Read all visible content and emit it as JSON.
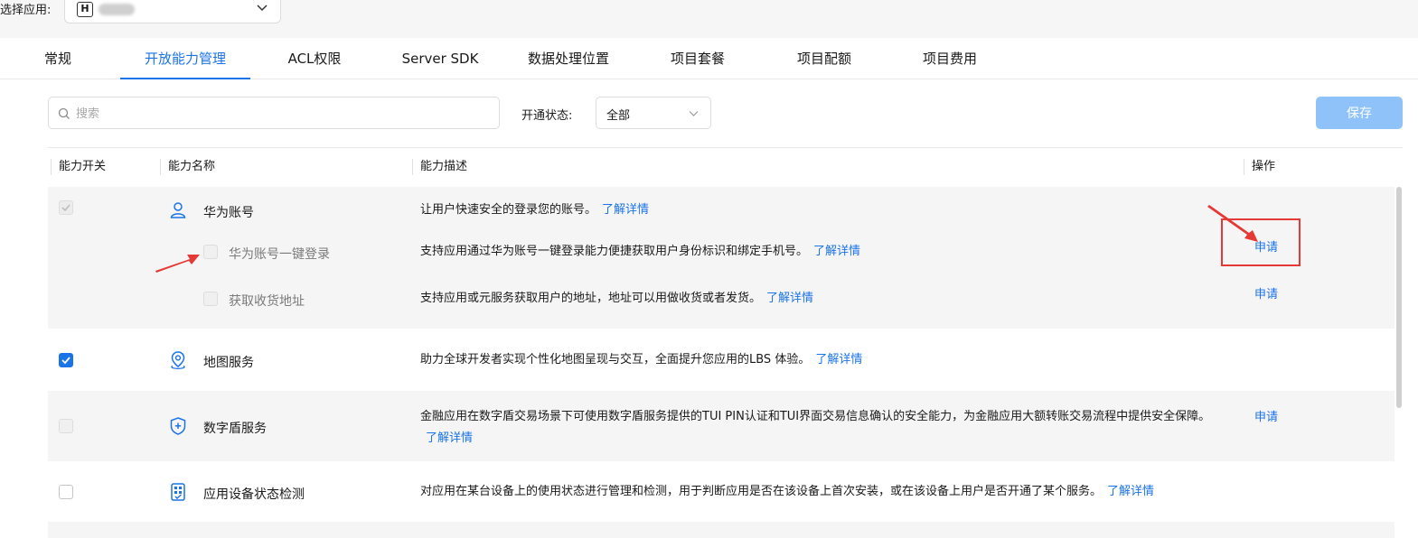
{
  "header": {
    "app_label": "选择应用:",
    "app_badge": "H"
  },
  "tabs": [
    "常规",
    "开放能力管理",
    "ACL权限",
    "Server SDK",
    "数据处理位置",
    "项目套餐",
    "项目配额",
    "项目费用"
  ],
  "active_tab": "开放能力管理",
  "filters": {
    "search_placeholder": "搜索",
    "status_label": "开通状态:",
    "status_value": "全部",
    "save_label": "保存"
  },
  "table": {
    "headers": [
      "能力开关",
      "能力名称",
      "能力描述",
      "操作"
    ],
    "link_text": "了解详情",
    "apply_text": "申请",
    "rows": [
      {
        "name": "华为账号",
        "icon": "user-icon",
        "checked": true,
        "disabled": true,
        "desc": "让用户快速安全的登录您的账号。",
        "action": ""
      },
      {
        "name": "华为账号一键登录",
        "icon": "",
        "checked": false,
        "disabled": true,
        "sub": true,
        "desc": "支持应用通过华为账号一键登录能力便捷获取用户身份标识和绑定手机号。",
        "action": "申请"
      },
      {
        "name": "获取收货地址",
        "icon": "",
        "checked": false,
        "disabled": true,
        "sub": true,
        "desc": "支持应用或元服务获取用户的地址，地址可以用做收货或者发货。",
        "action": "申请"
      },
      {
        "name": "地图服务",
        "icon": "map-pin-icon",
        "checked": true,
        "disabled": false,
        "desc": "助力全球开发者实现个性化地图呈现与交互，全面提升您应用的LBS 体验。",
        "action": ""
      },
      {
        "name": "数字盾服务",
        "icon": "shield-plus-icon",
        "checked": false,
        "disabled": true,
        "desc": "金融应用在数字盾交易场景下可使用数字盾服务提供的TUI PIN认证和TUI界面交易信息确认的安全能力，为金融应用大额转账交易流程中提供安全保障。",
        "action": "申请"
      },
      {
        "name": "应用设备状态检测",
        "icon": "device-check-icon",
        "checked": false,
        "disabled": false,
        "desc": "对应用在某台设备上的使用状态进行管理和检测，用于判断应用是否在该设备上首次安装，或在该设备上用户是否开通了某个服务。",
        "action": ""
      }
    ]
  },
  "colors": {
    "accent": "#1a73e8",
    "save_disabled": "#8fc2f8",
    "annotation": "#e53935"
  }
}
